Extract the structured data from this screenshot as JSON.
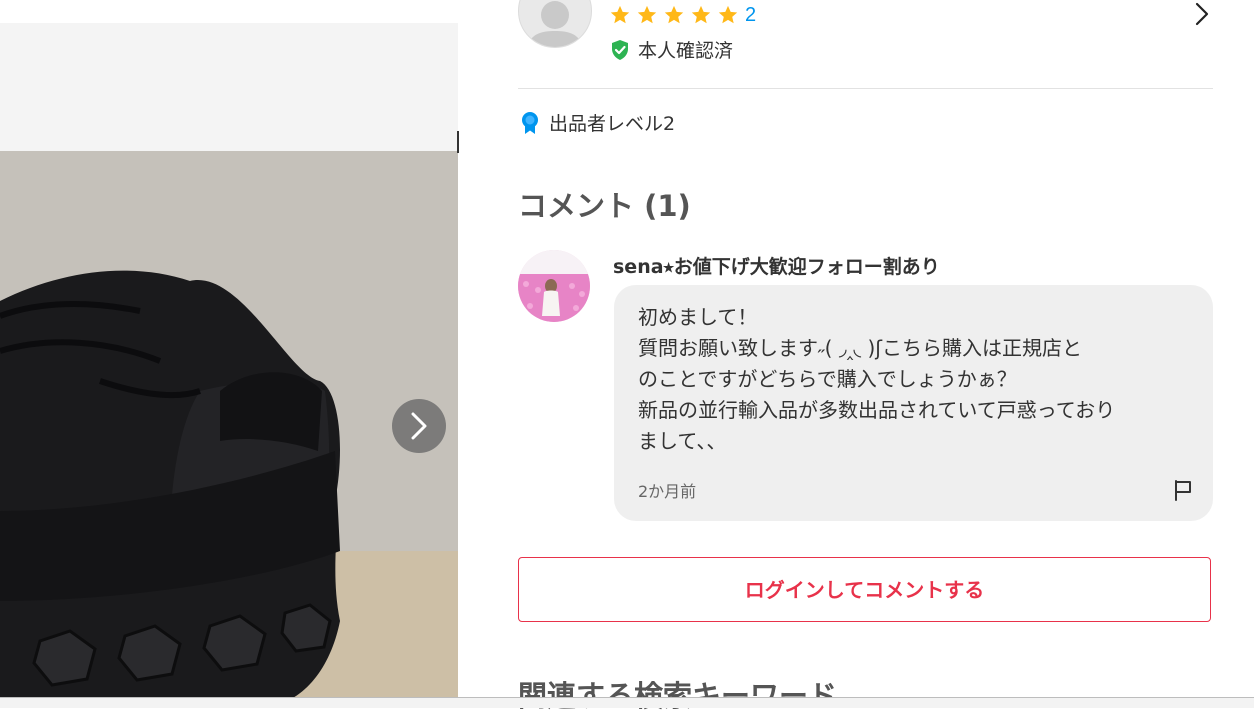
{
  "seller": {
    "rating_stars": 5,
    "rating_count": "2",
    "verified_label": "本人確認済",
    "level_label": "出品者レベル2"
  },
  "comments": {
    "title": "コメント (1)",
    "items": [
      {
        "author": "sena⭑お値下げ大歓迎フォロー割あり",
        "lines": [
          "初めまして！",
          "質問お願い致します˶( ◞‸◟ )ʃこちら購入は正規店と",
          "のことですがどちらで購入でしょうかぁ？",
          "新品の並行輸入品が多数出品されていて戸惑っており",
          "まして、、"
        ],
        "time": "2か月前"
      }
    ],
    "login_button": "ログインしてコメントする"
  },
  "related": {
    "title": "関連する検索キーワード"
  },
  "colors": {
    "star": "#ffb818",
    "rating_link": "#0095ee",
    "verified": "#2db352",
    "level_badge": "#0095ee",
    "accent": "#e8324a"
  },
  "icons": {
    "seller_avatar": "default-avatar-icon",
    "verified": "shield-check-icon",
    "level": "award-ribbon-icon",
    "next": "chevron-right-icon",
    "report": "flag-icon"
  }
}
